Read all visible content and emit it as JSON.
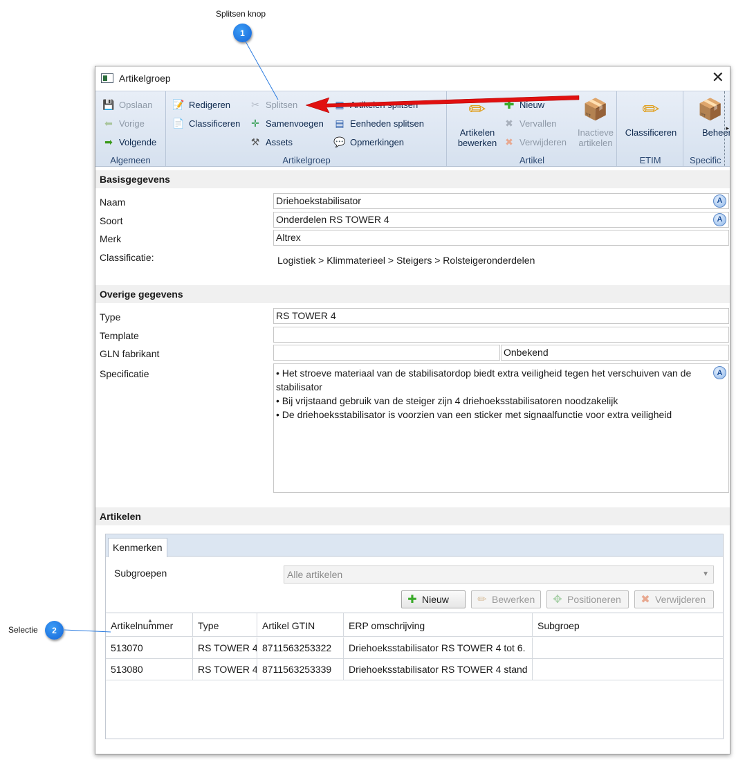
{
  "callouts": [
    {
      "number": "1",
      "label": "Splitsen knop"
    },
    {
      "number": "2",
      "label": "Selectie"
    }
  ],
  "window": {
    "title": "Artikelgroep",
    "close_icon": "close-icon"
  },
  "ribbon": {
    "algemeen": {
      "label": "Algemeen",
      "opslaan": "Opslaan",
      "vorige": "Vorige",
      "volgende": "Volgende"
    },
    "artikelgroep": {
      "label": "Artikelgroep",
      "redigeren": "Redigeren",
      "classificeren": "Classificeren",
      "splitsen": "Splitsen",
      "samenvoegen": "Samenvoegen",
      "assets": "Assets",
      "artikelen_splitsen": "Artikelen splitsen",
      "eenheden_splitsen": "Eenheden splitsen",
      "opmerkingen": "Opmerkingen"
    },
    "artikel": {
      "label": "Artikel",
      "artikelen_bewerken_1": "Artikelen",
      "artikelen_bewerken_2": "bewerken",
      "nieuw": "Nieuw",
      "vervallen": "Vervallen",
      "verwijderen": "Verwijderen",
      "inactieve_1": "Inactieve",
      "inactieve_2": "artikelen"
    },
    "etim": {
      "label": "ETIM",
      "classificeren": "Classificeren"
    },
    "specific": {
      "label": "Specific",
      "beheer": "Beheer"
    }
  },
  "basis": {
    "heading": "Basisgegevens",
    "naam_label": "Naam",
    "naam_value": "Driehoekstabilisator",
    "soort_label": "Soort",
    "soort_value": "Onderdelen RS TOWER 4",
    "merk_label": "Merk",
    "merk_value": "Altrex",
    "classificatie_label": "Classificatie:",
    "classificatie_value": "Logistiek > Klimmaterieel > Steigers > Rolsteigeronderdelen"
  },
  "overige": {
    "heading": "Overige gegevens",
    "type_label": "Type",
    "type_value": "RS TOWER 4",
    "template_label": "Template",
    "template_value": "",
    "gln_label": "GLN fabrikant",
    "gln_value": "",
    "gln_status": "Onbekend",
    "spec_label": "Specificatie",
    "spec_lines": [
      "• Het stroeve materiaal van de stabilisatordop biedt extra veiligheid tegen het verschuiven van de stabilisator",
      "• Bij vrijstaand gebruik van de steiger zijn 4 driehoeksstabilisatoren noodzakelijk",
      "• De driehoeksstabilisator is voorzien van een sticker met signaalfunctie voor extra veiligheid"
    ]
  },
  "artikelen": {
    "heading": "Artikelen",
    "tab": "Kenmerken",
    "subgroepen_label": "Subgroepen",
    "subgroepen_value": "Alle artikelen",
    "buttons": {
      "nieuw": "Nieuw",
      "bewerken": "Bewerken",
      "positioneren": "Positioneren",
      "verwijderen": "Verwijderen"
    },
    "columns": [
      "Artikelnummer",
      "Type",
      "Artikel GTIN",
      "ERP omschrijving",
      "Subgroep"
    ],
    "rows": [
      [
        "513070",
        "RS TOWER 4",
        "8711563253322",
        "Driehoeksstabilisator RS TOWER 4 tot 6.",
        ""
      ],
      [
        "513080",
        "RS TOWER 4",
        "8711563253339",
        "Driehoeksstabilisator RS TOWER 4 stand",
        ""
      ]
    ]
  },
  "colors": {
    "accent": "#1565d8",
    "arrow": "#e01010",
    "ribbon": "#dde6f2"
  }
}
